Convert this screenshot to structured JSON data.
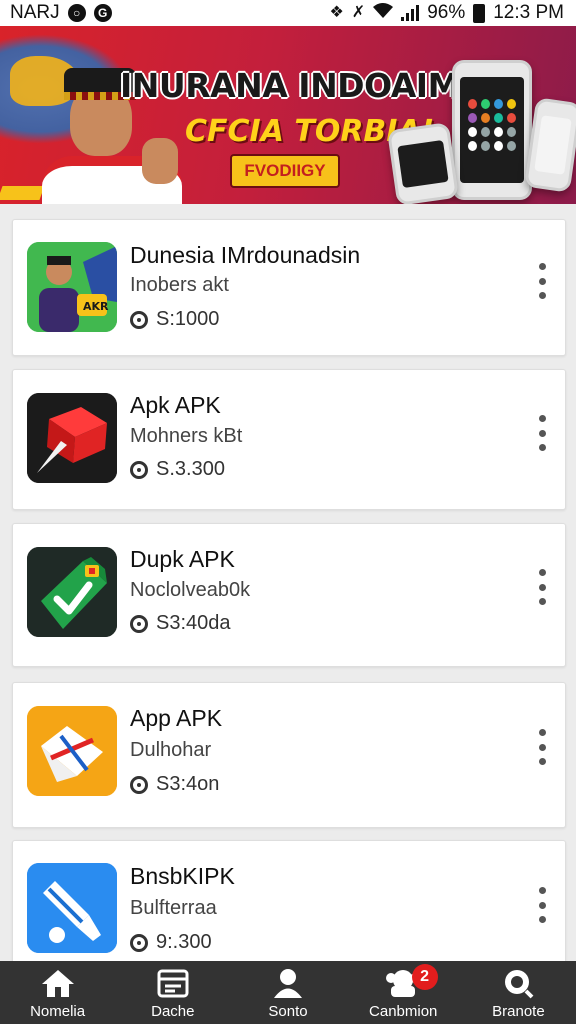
{
  "status_bar": {
    "carrier": "NARJ",
    "battery": "96%",
    "time": "12:3 PM",
    "icons": [
      "alarm-icon",
      "notification-icon",
      "bluetooth-icon",
      "mute-icon",
      "wifi-icon",
      "signal-icon",
      "battery-icon"
    ]
  },
  "banner": {
    "title": "INURANA INDOAIMAN",
    "subtitle": "CFCIA TORBIA!",
    "cta": "FVODIIGY",
    "colors": {
      "background": "#d9232a",
      "title": "#1a1a1a",
      "subtitle": "#ffd21a",
      "cta_bg": "#f7c21a"
    }
  },
  "apps": [
    {
      "name": "Dunesia IMrdounadsin",
      "description": "Inobers akt",
      "price": "S:1000",
      "icon": "app-icon-person",
      "icon_colors": [
        "#3bb54a",
        "#1e7a2c"
      ]
    },
    {
      "name": "Apk APK",
      "description": "Mohners kBt",
      "price": "S.3.300",
      "icon": "app-icon-red-cube",
      "icon_colors": [
        "#1b1b1b",
        "#e02424"
      ]
    },
    {
      "name": "Dupk APK",
      "description": "Noclolveab0k",
      "price": "S3:40da",
      "icon": "app-icon-green-check",
      "icon_colors": [
        "#1b1b1b",
        "#22a34a"
      ]
    },
    {
      "name": "App APK",
      "description": "Dulhohar",
      "price": "S3:4on",
      "icon": "app-icon-envelope",
      "icon_colors": [
        "#f5a515",
        "#f7c84a"
      ]
    },
    {
      "name": "BnsbKIPK",
      "description": "Bulfterraa",
      "price": "9:.300",
      "icon": "app-icon-brush",
      "icon_colors": [
        "#1b7fe8",
        "#4aa8ff"
      ]
    }
  ],
  "bottom_nav": {
    "items": [
      {
        "label": "Nomelia",
        "icon": "home-icon"
      },
      {
        "label": "Dache",
        "icon": "calendar-icon"
      },
      {
        "label": "Sonto",
        "icon": "person-icon"
      },
      {
        "label": "Canbmion",
        "icon": "community-icon",
        "badge": "2"
      },
      {
        "label": "Branote",
        "icon": "search-icon"
      }
    ]
  }
}
